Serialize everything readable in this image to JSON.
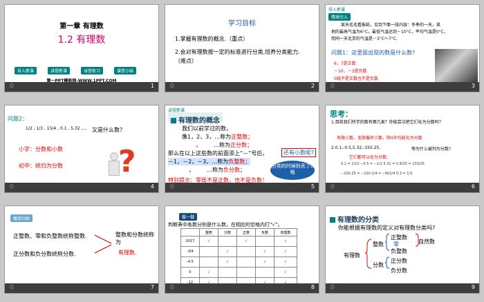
{
  "slides": [
    {
      "num": "1",
      "chapter": "第一章  有理数",
      "title": "1.2  有理数",
      "nav": [
        "导入新课",
        "讲授新课",
        "当堂练习",
        "课堂小结"
      ],
      "footer": "第一PPT模板网-WWW.1PPT.COM"
    },
    {
      "num": "2",
      "heading": "学习目标",
      "items": [
        "1.掌握有理数的概念.（重点）",
        "2.会对有理数按一定的标准进行分类,培养分类能力.（难点）"
      ]
    },
    {
      "num": "3",
      "section": "导入新课",
      "tag": "情境引入",
      "text": [
        "某天毛毛看报纸，见到下面一段内容：冬季的一天，某",
        "地的最高气温为6°C，最低气温达到－10°C，平均气温是0°C，",
        "而同一天北京的气温是－3°C～7°C."
      ],
      "question": "问题1：这里面出现的数是什么数?",
      "answers": [
        "6，7是正数",
        "－10，－3是负数",
        "0既不是正数也不是负数"
      ]
    },
    {
      "num": "4",
      "label": "问题2：",
      "numbers": "1/2 , 1/3 , 15/4 , 0.1 , 5.32 ,…",
      "question": "又是什么数？",
      "line1": "小学：分数和小数",
      "line2": "初中：统归为分数"
    },
    {
      "num": "5",
      "section": "讲授新课",
      "heading": "有理数的概念",
      "lines": [
        "我们以前学过的数，",
        "像1，2，3，…称为",
        "，",
        "…称为",
        "那么在以上这些数的前面添上“－”号后，",
        "－1，－2，－3，…称为",
        "，",
        "…称为"
      ],
      "blanks": [
        "正整数；",
        "正分数；",
        "负整数；",
        "负分数；"
      ],
      "callout1": "还有小数呢?",
      "callout2": "分类的时候别丢了0哦",
      "tip": "特别提示：零既不是正数，也不是负数！"
    },
    {
      "num": "6",
      "heading": "思考：",
      "q1": "1.目前我们所学的数有哪几类？你能尝试把它们化为分数吗？",
      "a1": "有限小数，无限循环小数，除π外均能化为分数",
      "q2": "2.0.1,-0.5,5.32,-150.25,",
      "q2b": "等为什么被列为分数?",
      "a2": "它们都可以化为分数："
    },
    {
      "num": "7",
      "tag": "概念归纳",
      "l1": "正整数、零和负整数统称整数.",
      "l2": "正分数和负分数统称分数.",
      "r1": "整数和分数统称为",
      "r2": "有理数."
    },
    {
      "num": "8",
      "tag": "做一做",
      "prompt": "判断表中各数分别是什么数，在相应的空格内打“√”。",
      "headers": [
        "",
        "整数",
        "分数",
        "正数",
        "负数",
        "有理数"
      ],
      "rows": [
        "2017",
        "-3/4",
        "-4.5",
        "0",
        "-12"
      ],
      "check": "√"
    },
    {
      "num": "9",
      "heading": "有理数的分类",
      "question": "你能根据有理数的定义对有理数分类吗?",
      "root": "有理数",
      "zheng": "整数",
      "fen": "分数",
      "zz": "正整数",
      "zero": "零",
      "fz": "负整数",
      "zf": "正分数",
      "ff": "负分数",
      "ziran": "自然数"
    }
  ],
  "colors": {
    "teal": "#008080",
    "red": "#e30000",
    "dark_bar": "#3d3d3d"
  }
}
